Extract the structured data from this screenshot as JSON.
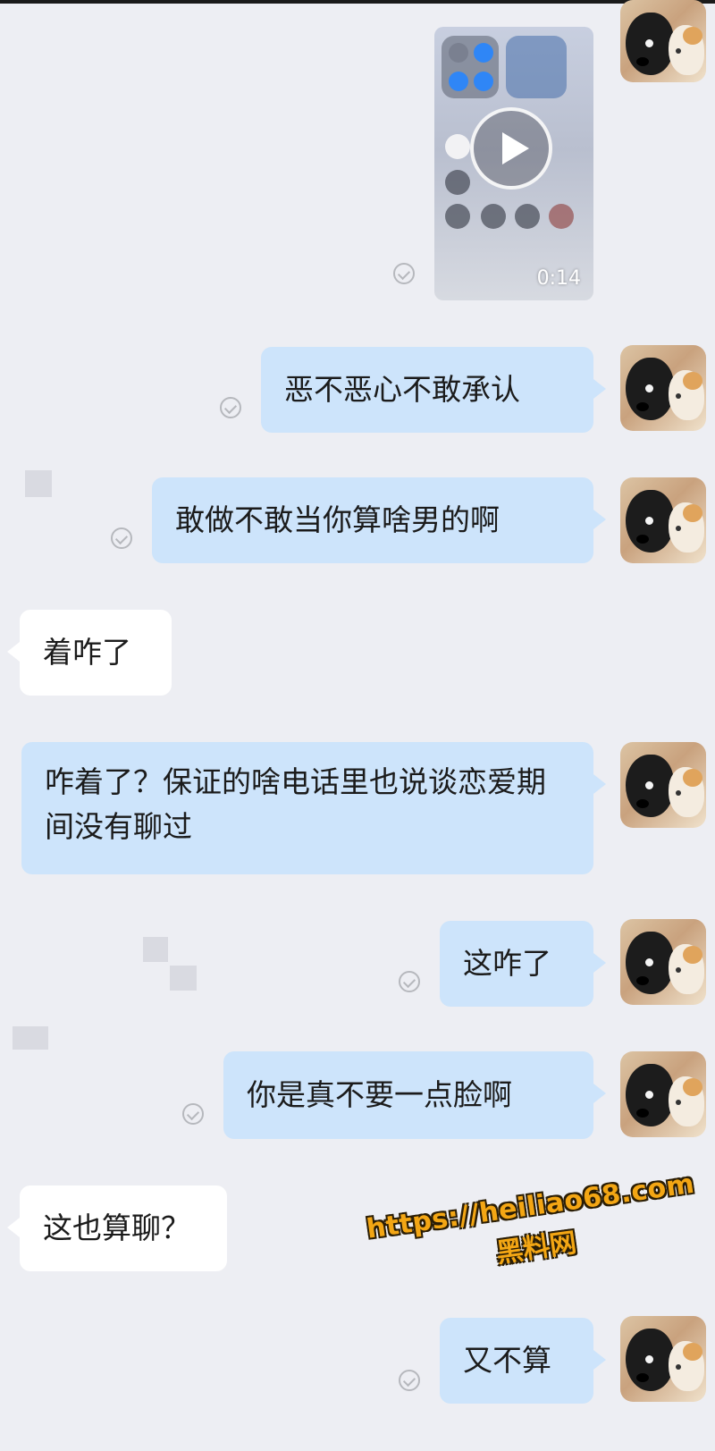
{
  "video": {
    "duration": "0:14"
  },
  "messages": [
    {
      "side": "mine",
      "text": "恶不恶心不敢承认"
    },
    {
      "side": "mine",
      "text": "敢做不敢当你算啥男的啊"
    },
    {
      "side": "theirs",
      "text": "着咋了"
    },
    {
      "side": "mine",
      "text": "咋着了？保证的啥电话里也说谈恋爱期间没有聊过"
    },
    {
      "side": "mine",
      "text": "这咋了"
    },
    {
      "side": "mine",
      "text": "你是真不要一点脸啊"
    },
    {
      "side": "theirs",
      "text": "这也算聊？"
    },
    {
      "side": "mine",
      "text": "又不算"
    }
  ],
  "watermark": {
    "url": "https://heiliao68.com",
    "site": "黑料网"
  },
  "colors": {
    "background": "#edeef3",
    "my_bubble": "#cde4fb",
    "their_bubble": "#ffffff",
    "watermark": "#f3a614"
  }
}
